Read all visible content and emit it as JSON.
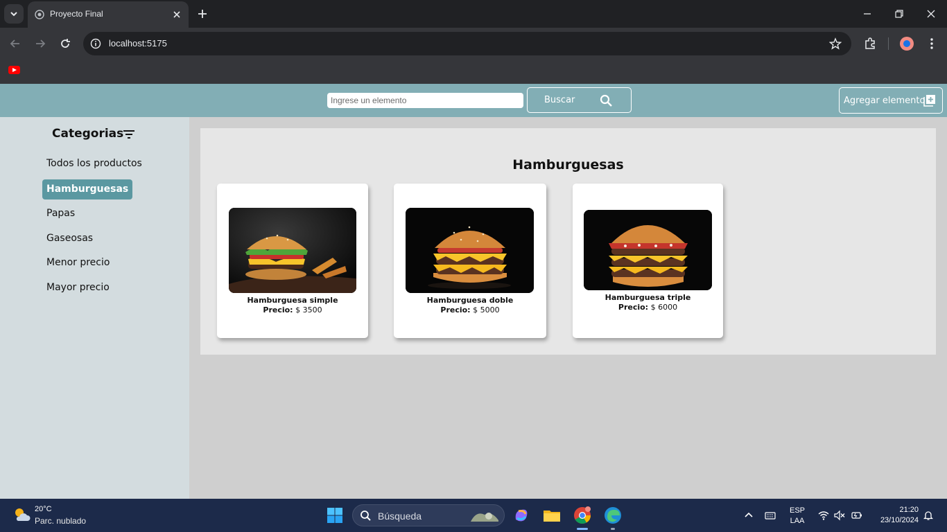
{
  "browser": {
    "tab_title": "Proyecto Final",
    "url": "localhost:5175"
  },
  "header": {
    "search_placeholder": "Ingrese un elemento",
    "search_button": "Buscar",
    "add_button": "Agregar elemento"
  },
  "sidebar": {
    "title": "Categorias",
    "items": [
      {
        "label": "Todos los productos",
        "active": false
      },
      {
        "label": "Hamburguesas",
        "active": true
      },
      {
        "label": "Papas",
        "active": false
      },
      {
        "label": "Gaseosas",
        "active": false
      },
      {
        "label": "Menor precio",
        "active": false
      },
      {
        "label": "Mayor precio",
        "active": false
      }
    ]
  },
  "main": {
    "section_title": "Hamburguesas",
    "products": [
      {
        "name": "Hamburguesa simple",
        "price_label": "Precio:",
        "price": "$ 3500"
      },
      {
        "name": "Hamburguesa doble",
        "price_label": "Precio:",
        "price": "$ 5000"
      },
      {
        "name": "Hamburguesa triple",
        "price_label": "Precio:",
        "price": "$ 6000"
      }
    ]
  },
  "taskbar": {
    "weather_temp": "20°C",
    "weather_desc": "Parc. nublado",
    "search_label": "Búsqueda",
    "lang_top": "ESP",
    "lang_bottom": "LAA",
    "time": "21:20",
    "date": "23/10/2024"
  },
  "colors": {
    "header_bg": "#82aeb5",
    "sidebar_bg": "#d3dcdf",
    "active_category": "#5b98a1",
    "content_bg": "#e6e6e6"
  }
}
